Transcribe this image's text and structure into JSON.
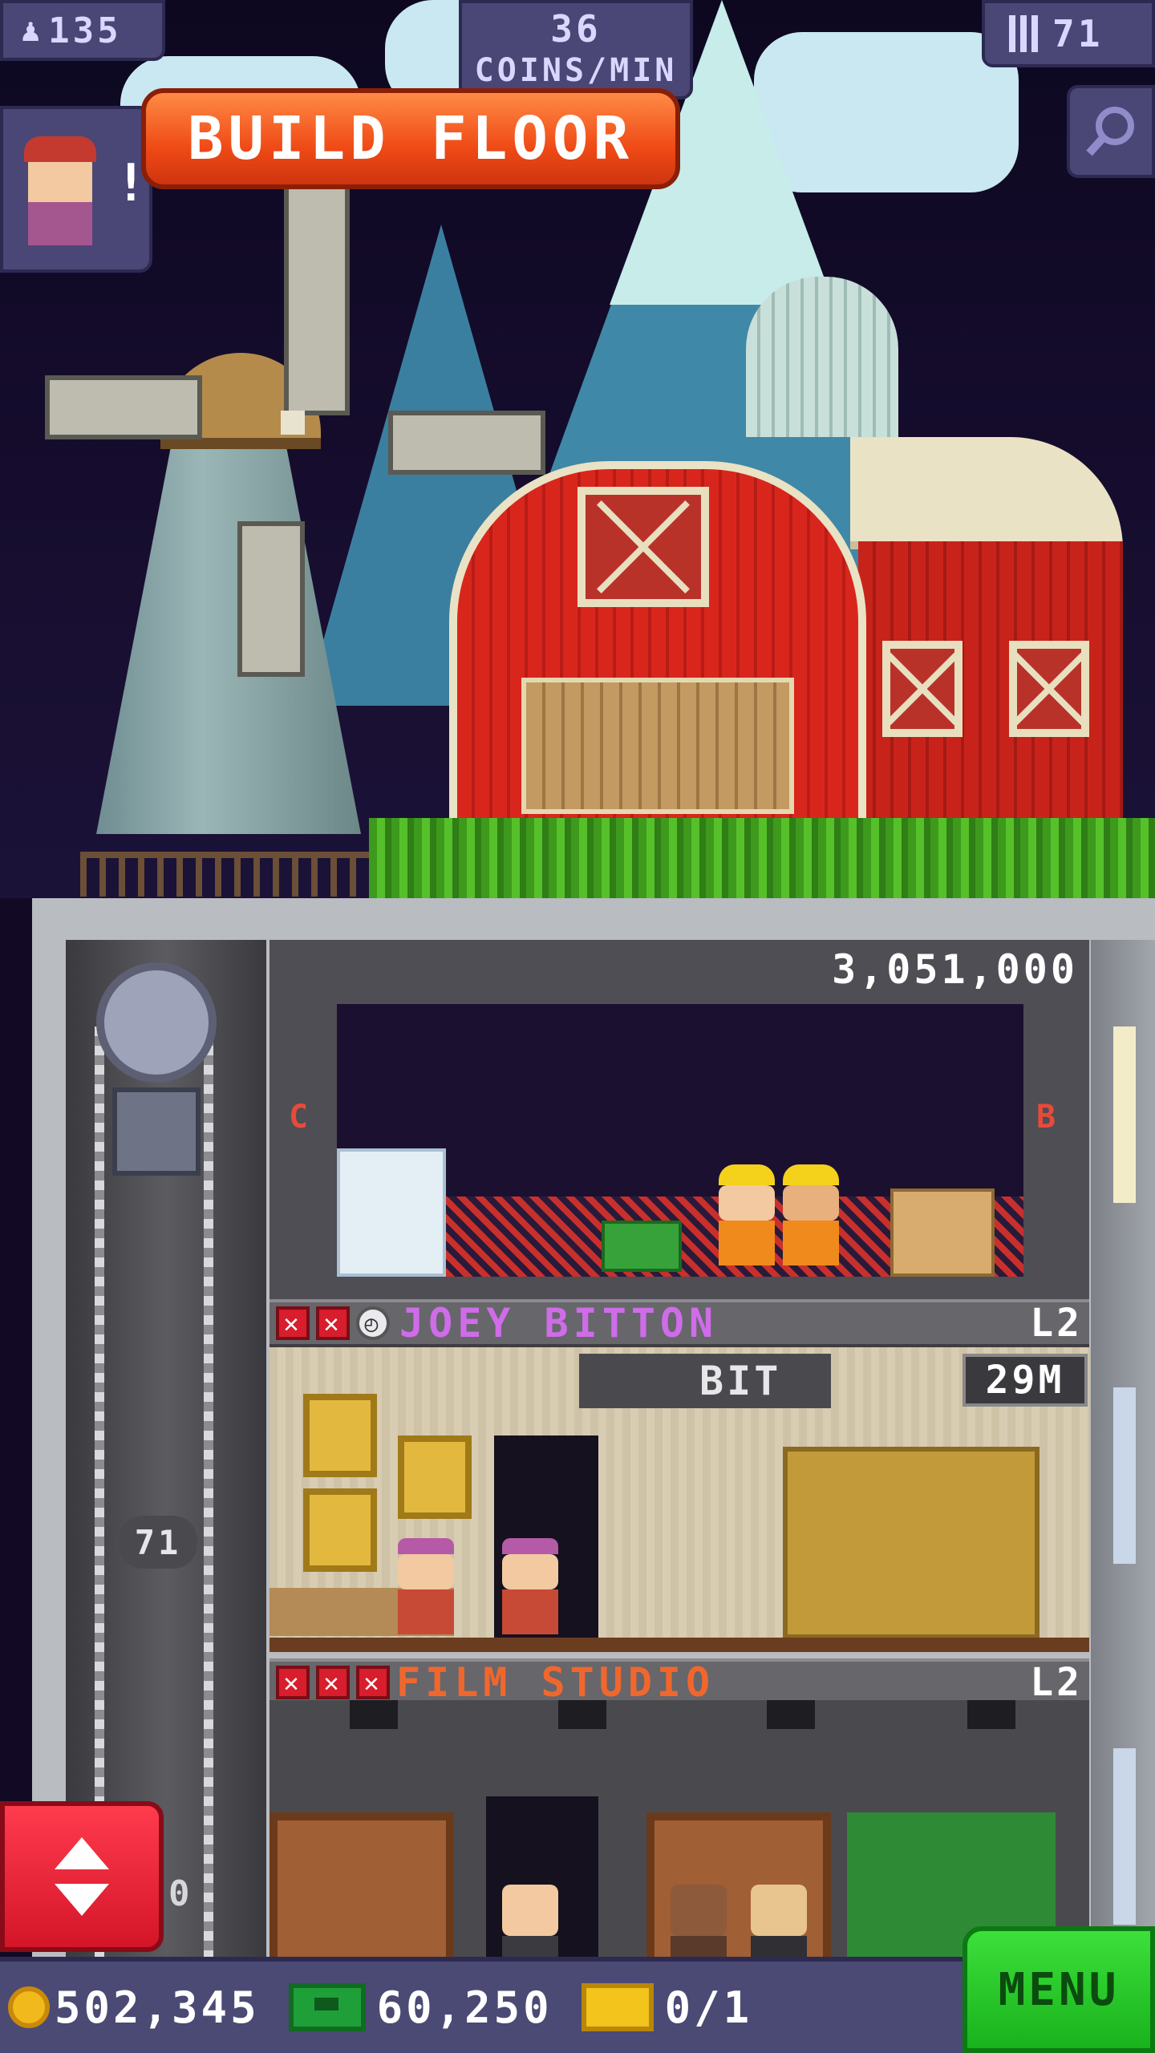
{
  "hud": {
    "population": "135",
    "coins_per_min_value": "36",
    "coins_per_min_label": "COINS/MIN",
    "floors": "71",
    "avatar_alert": "!"
  },
  "icons": {
    "population": "person-icon",
    "floors": "building-icon",
    "search": "magnifier-icon",
    "elevator": "up-down-arrows-icon",
    "coin": "coin-icon",
    "bux": "bux-banknote-icon",
    "ticket": "vip-ticket-icon"
  },
  "build_floor": {
    "cost": "3,051,000",
    "button_label": "BUILD FLOOR",
    "left_letter": "C",
    "right_letter": "B"
  },
  "floors": [
    {
      "name": "JOEY BITTON",
      "name_color": "#cf6ce8",
      "level": "L2",
      "sign": "BIT",
      "value": "29M",
      "status": [
        "x",
        "x",
        "clock"
      ]
    },
    {
      "name": "FILM STUDIO",
      "name_color": "#f0672e",
      "level": "L2",
      "status": [
        "x",
        "x",
        "x"
      ]
    }
  ],
  "elevator": {
    "floor_label": "71",
    "lower_label": "0"
  },
  "bottom_bar": {
    "coins": "502,345",
    "bux": "60,250",
    "tickets": "0/1",
    "menu_label": "MENU"
  },
  "colors": {
    "build_button": "#ef4a16",
    "menu_button": "#19b21d",
    "elevator_button": "#d41528",
    "hud_panel": "#4a4676"
  }
}
